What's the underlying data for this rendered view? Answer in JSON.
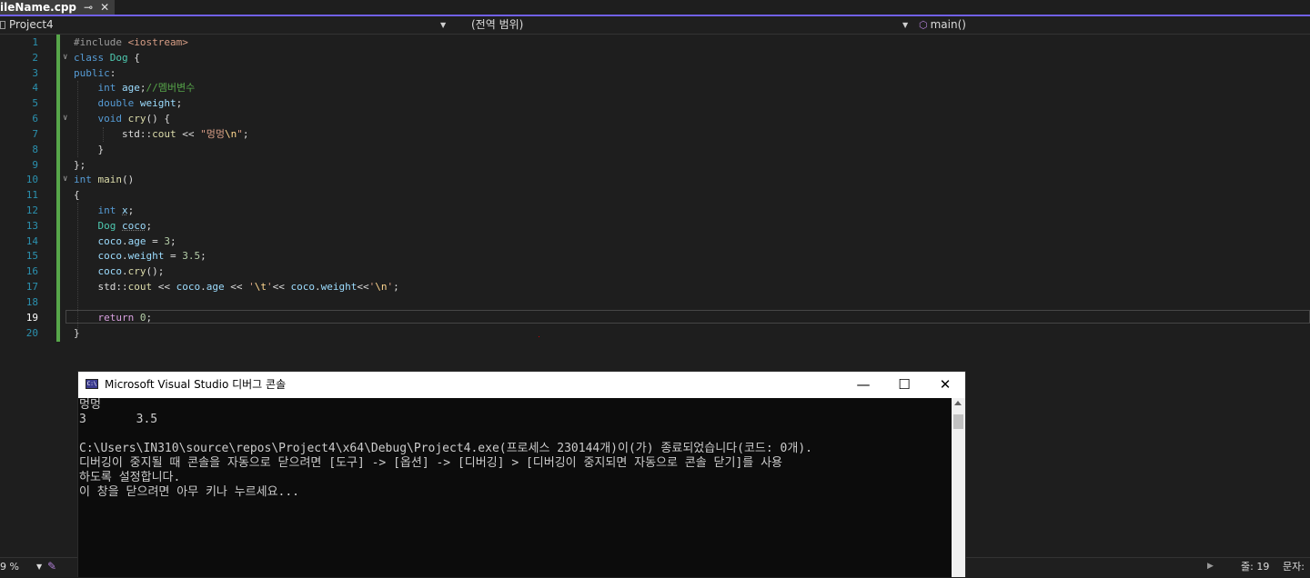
{
  "tab": {
    "title": "ileName.cpp",
    "pin_icon": "⊸",
    "close_icon": "✕"
  },
  "navbar": {
    "project": "Project4",
    "scope": "(전역 범위)",
    "member": "main()"
  },
  "editor": {
    "line_numbers": [
      "1",
      "2",
      "3",
      "4",
      "5",
      "6",
      "7",
      "8",
      "9",
      "10",
      "11",
      "12",
      "13",
      "14",
      "15",
      "16",
      "17",
      "18",
      "19",
      "20"
    ],
    "current_line": "19"
  },
  "console": {
    "title": "Microsoft Visual Studio 디버그 콘솔",
    "icon_text": "C:\\",
    "lines": [
      "멍멍",
      "3       3.5",
      "",
      "C:\\Users\\IN310\\source\\repos\\Project4\\x64\\Debug\\Project4.exe(프로세스 230144개)이(가) 종료되었습니다(코드: 0개).",
      "디버깅이 중지될 때 콘솔을 자동으로 닫으려면 [도구] -> [옵션] -> [디버깅] > [디버깅이 중지되면 자동으로 콘솔 닫기]를 사용",
      "하도록 설정합니다.",
      "이 창을 닫으려면 아무 키나 누르세요..."
    ]
  },
  "status": {
    "zoom": "9 %",
    "line_label": "줄: 19",
    "col_label": "문자:"
  }
}
